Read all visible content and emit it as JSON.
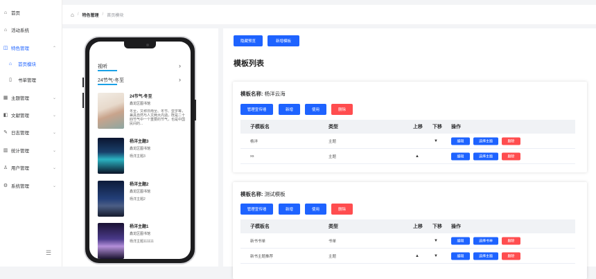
{
  "sidebar": {
    "items": [
      {
        "label": "首页",
        "icon": "home-icon"
      },
      {
        "label": "活动系统",
        "icon": "home-icon"
      },
      {
        "label": "特色管理",
        "icon": "bag-icon"
      },
      {
        "label": "首页模块",
        "icon": "home-icon"
      },
      {
        "label": "书单管理",
        "icon": "book-icon"
      },
      {
        "label": "主题管理",
        "icon": "grid-icon"
      },
      {
        "label": "文献管理",
        "icon": "doc-icon"
      },
      {
        "label": "日志管理",
        "icon": "edit-icon"
      },
      {
        "label": "统计管理",
        "icon": "chart-icon"
      },
      {
        "label": "用户管理",
        "icon": "user-icon"
      },
      {
        "label": "系统管理",
        "icon": "gear-icon"
      }
    ]
  },
  "breadcrumb": {
    "level1": "特色管理",
    "level2": "首页模块"
  },
  "phone": {
    "row1": "视听",
    "row2": "24节气-冬至",
    "cards": [
      {
        "title": "24节气-冬至",
        "lib": "鑫龙区图书馆",
        "desc": "冬至，又称日南至、冬节、亚岁等，兼具自然与人文两大内涵，既是二十四节气中一个重要的节气，也是中国民间的..."
      },
      {
        "title": "杨洋主题3",
        "lib": "鑫龙区图书馆",
        "desc": "杨洋主题3"
      },
      {
        "title": "杨洋主题2",
        "lib": "鑫龙区图书馆",
        "desc": "杨洋主题2"
      },
      {
        "title": "杨洋主题1",
        "lib": "鑫龙区图书馆",
        "desc": "杨洋主题111111"
      }
    ]
  },
  "main": {
    "btn_hide_preview": "隐藏预览",
    "btn_new_template": "新增模板",
    "heading": "模板列表",
    "name_label": "模板名称:",
    "btn_manage": "管理宣传墙",
    "btn_add": "新增",
    "btn_use": "使用",
    "btn_delete": "删除",
    "columns": [
      "子模板名",
      "类型",
      "上移",
      "下移",
      "操作"
    ],
    "templates": [
      {
        "name": "杨洋云海",
        "rows": [
          {
            "name": "杨洋",
            "type": "主题",
            "up": "",
            "down": "▼",
            "edit": "编辑",
            "select": "选择主题",
            "del": "删除"
          },
          {
            "name": "xs",
            "type": "主题",
            "up": "▲",
            "down": "",
            "edit": "编辑",
            "select": "选择主题",
            "del": "删除"
          }
        ]
      },
      {
        "name": "测试模板",
        "rows": [
          {
            "name": "新书书单",
            "type": "书单",
            "up": "",
            "down": "▼",
            "edit": "编辑",
            "select": "选择书单",
            "del": "删除"
          },
          {
            "name": "新书主题推荐",
            "type": "主题",
            "up": "▲",
            "down": "▼",
            "edit": "编辑",
            "select": "选择主题",
            "del": "删除"
          }
        ]
      }
    ]
  },
  "colors": {
    "primary": "#1e63ff",
    "danger": "#ff4d4f"
  }
}
